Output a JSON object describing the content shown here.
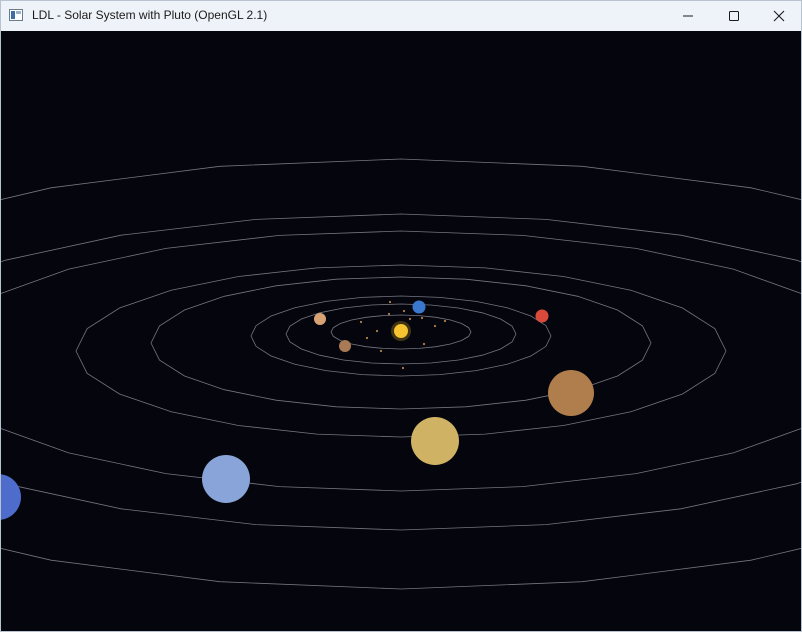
{
  "window": {
    "title": "LDL - Solar System with Pluto (OpenGL 2.1)",
    "icon": "app-window-icon",
    "controls": {
      "minimize_icon": "minimize-icon",
      "maximize_icon": "maximize-icon",
      "close_icon": "close-icon"
    }
  },
  "scene": {
    "background_color": "#05050d",
    "orbit_color": "#8a8a96",
    "sun": {
      "name": "sun",
      "color": "#f5c430"
    },
    "planets": [
      {
        "name": "mercury",
        "color": "#a87a55"
      },
      {
        "name": "venus",
        "color": "#d9a274"
      },
      {
        "name": "earth",
        "color": "#3a78d0"
      },
      {
        "name": "mars",
        "color": "#d94a3c"
      },
      {
        "name": "jupiter",
        "color": "#b07d4c"
      },
      {
        "name": "saturn",
        "color": "#cfb263"
      },
      {
        "name": "uranus",
        "color": "#88a4d8"
      },
      {
        "name": "neptune",
        "color": "#4e6ccc"
      }
    ],
    "asteroid_color": "#b0844a"
  }
}
